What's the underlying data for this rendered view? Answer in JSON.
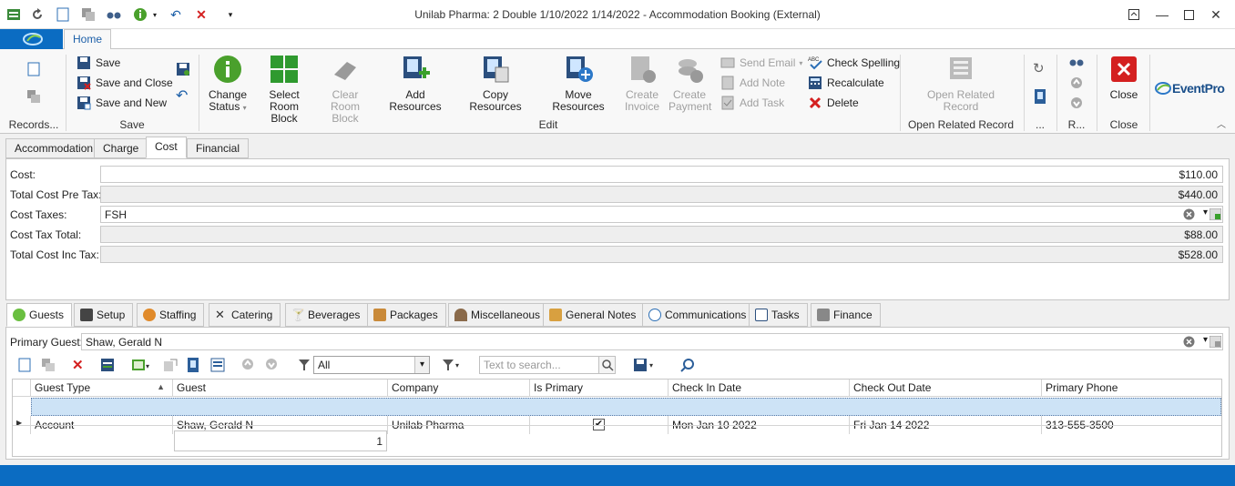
{
  "window": {
    "title": "Unilab Pharma: 2 Double 1/10/2022 1/14/2022  - Accommodation Booking (External)"
  },
  "ribbon": {
    "tab_home": "Home",
    "groups": {
      "records": "Records...",
      "save": "Save",
      "edit": "Edit",
      "open_related": "Open Related Record",
      "more": "...",
      "r": "R...",
      "close": "Close"
    },
    "save_label": "Save",
    "save_close_label": "Save and Close",
    "save_new_label": "Save and New",
    "change_status_label": [
      "Change",
      "Status"
    ],
    "select_room_block_label": [
      "Select",
      "Room Block"
    ],
    "clear_room_block_label": [
      "Clear Room",
      "Block"
    ],
    "add_resources_label": "Add Resources",
    "copy_resources_label": "Copy Resources",
    "move_resources_label": "Move Resources",
    "create_invoice_label": [
      "Create",
      "Invoice"
    ],
    "create_payment_label": [
      "Create",
      "Payment"
    ],
    "send_email_label": "Send Email",
    "add_note_label": "Add Note",
    "add_task_label": "Add Task",
    "check_spelling_label": "Check Spelling",
    "recalculate_label": "Recalculate",
    "delete_label": "Delete",
    "open_related_label": [
      "Open Related",
      "Record"
    ],
    "close_label": "Close",
    "brand": "EventPro"
  },
  "form_tabs": [
    "Accommodation",
    "Charge",
    "Cost",
    "Financial"
  ],
  "active_form_tab": "Cost",
  "cost_fields": {
    "cost_label": "Cost:",
    "cost_value": "$110.00",
    "total_pre_tax_label": "Total Cost Pre Tax:",
    "total_pre_tax_value": "$440.00",
    "cost_taxes_label": "Cost Taxes:",
    "cost_taxes_value": "FSH",
    "cost_tax_total_label": "Cost Tax Total:",
    "cost_tax_total_value": "$88.00",
    "total_inc_tax_label": "Total Cost Inc Tax:",
    "total_inc_tax_value": "$528.00"
  },
  "lower_tabs": [
    "Guests",
    "Setup",
    "Staffing",
    "Catering",
    "Beverages",
    "Packages",
    "Miscellaneous",
    "General Notes",
    "Communications",
    "Tasks",
    "Finance"
  ],
  "active_lower_tab": "Guests",
  "guests": {
    "primary_guest_label": "Primary Guest:",
    "primary_guest_value": "Shaw, Gerald N",
    "filter_value": "All",
    "search_placeholder": "Text to search...",
    "columns": [
      "Guest Type",
      "Guest",
      "Company",
      "Is Primary",
      "Check In Date",
      "Check Out Date",
      "Primary Phone"
    ],
    "rows": [
      [
        "Account",
        "Shaw, Gerald N",
        "Unilab Pharma",
        "",
        "Mon Jan 10 2022",
        "Fri Jan 14 2022",
        "313-555-3500"
      ]
    ],
    "row_is_primary": [
      true
    ],
    "footer_count": "1"
  },
  "colors": {
    "accent": "#0b6cc2",
    "selected_row": "#cde3f6"
  }
}
